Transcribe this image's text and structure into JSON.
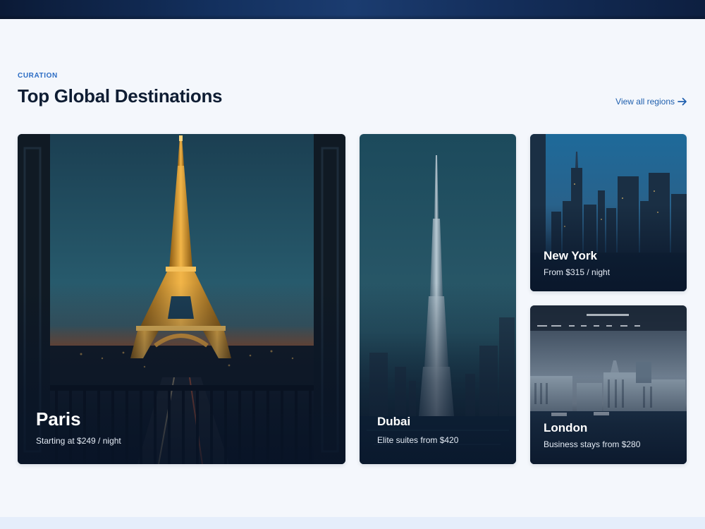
{
  "section": {
    "eyebrow": "CURATION",
    "title": "Top Global Destinations",
    "view_all_label": "View all regions"
  },
  "icons": {
    "view_all": "arrow-right-icon"
  },
  "destinations": [
    {
      "city": "Paris",
      "price": "Starting at $249 / night",
      "image": "eiffel-tower-balcony-dusk"
    },
    {
      "city": "Dubai",
      "price": "Elite suites from $420",
      "image": "burj-khalifa-skyline"
    },
    {
      "city": "New York",
      "price": "From $315 / night",
      "image": "manhattan-skyline-night"
    },
    {
      "city": "London",
      "price": "Business stays from $280",
      "image": "london-river-cloudy"
    }
  ],
  "colors": {
    "accent": "#2b6cc4",
    "link": "#1f5fae",
    "title": "#0f1d33",
    "background": "#f4f7fc"
  }
}
